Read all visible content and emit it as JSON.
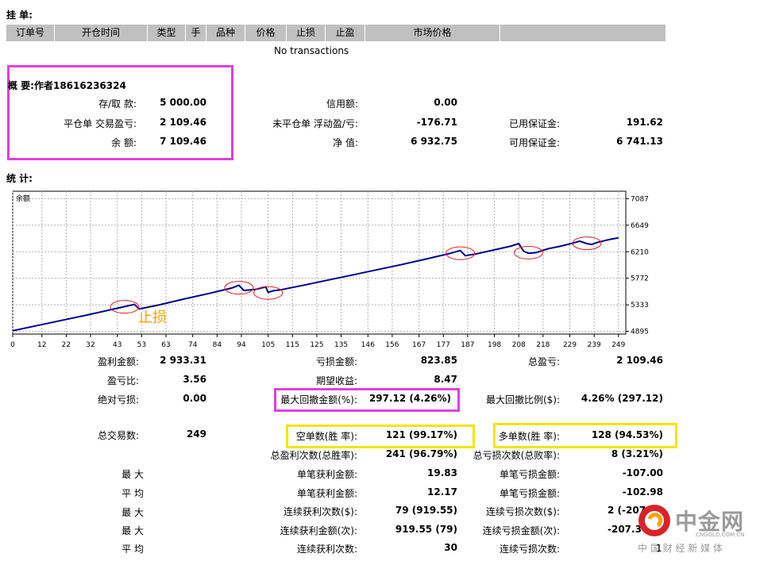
{
  "pending": {
    "title": "挂 单:",
    "columns": [
      "订单号",
      "开仓时间",
      "类型",
      "手",
      "品种",
      "价格",
      "止损",
      "止盈",
      "市场价格",
      ""
    ],
    "empty_text": "No transactions"
  },
  "summary": {
    "title": "概 要:作者18616236324",
    "rows": [
      {
        "label": "存/取 款:",
        "value": "5 000.00"
      },
      {
        "label": "平仓单 交易盈亏:",
        "value": "2 109.46"
      },
      {
        "label": "余 额:",
        "value": "7 109.46"
      },
      {
        "label": "信用额:",
        "value": "0.00"
      },
      {
        "label": "未平仓单 浮动盈/亏:",
        "value": "-176.71"
      },
      {
        "label": "净 值:",
        "value": "6 932.75"
      },
      {
        "label": "已用保证金:",
        "value": "191.62"
      },
      {
        "label": "可用保证金:",
        "value": "6 741.13"
      }
    ]
  },
  "stats_title": "统 计:",
  "chart_data": {
    "type": "line",
    "title": "余额",
    "x_ticks": [
      0,
      12,
      22,
      32,
      43,
      53,
      63,
      74,
      84,
      94,
      105,
      115,
      125,
      135,
      146,
      156,
      167,
      177,
      187,
      198,
      208,
      218,
      229,
      239,
      249
    ],
    "xlim": [
      0,
      252
    ],
    "y_ticks": [
      4895,
      5333,
      5772,
      6210,
      6649,
      7087
    ],
    "ylim": [
      4850,
      7210
    ],
    "grid": true,
    "annotation": "止损",
    "series": [
      {
        "color": "#00008b",
        "x": [
          0,
          10,
          20,
          30,
          40,
          50,
          52,
          60,
          70,
          80,
          90,
          93,
          95,
          100,
          104,
          105,
          107,
          110,
          120,
          130,
          140,
          150,
          160,
          170,
          180,
          184,
          186,
          190,
          200,
          205,
          208,
          210,
          212,
          215,
          220,
          225,
          230,
          233,
          236,
          238,
          240,
          245,
          249
        ],
        "y": [
          4905,
          4990,
          5075,
          5160,
          5250,
          5340,
          5265,
          5330,
          5425,
          5515,
          5610,
          5655,
          5570,
          5590,
          5630,
          5540,
          5565,
          5580,
          5660,
          5745,
          5830,
          5915,
          6000,
          6090,
          6185,
          6230,
          6145,
          6170,
          6260,
          6305,
          6345,
          6220,
          6185,
          6195,
          6260,
          6300,
          6350,
          6385,
          6345,
          6330,
          6360,
          6410,
          6440
        ]
      }
    ],
    "circles": [
      {
        "x": 46,
        "y": 5300
      },
      {
        "x": 93,
        "y": 5615
      },
      {
        "x": 105,
        "y": 5530
      },
      {
        "x": 184,
        "y": 6185
      },
      {
        "x": 212,
        "y": 6195
      },
      {
        "x": 236,
        "y": 6350
      }
    ]
  },
  "stats": [
    {
      "label": "盈利金额:",
      "value": "2 933.31"
    },
    {
      "label": "盈亏比:",
      "value": "3.56"
    },
    {
      "label": "绝对亏损:",
      "value": "0.00"
    },
    {
      "label": "总交易数:",
      "value": "249"
    },
    {
      "label": "最 大",
      "value": ""
    },
    {
      "label": "平 均",
      "value": ""
    },
    {
      "label": "最 大",
      "value": ""
    },
    {
      "label": "最 大",
      "value": ""
    },
    {
      "label": "平 均",
      "value": ""
    },
    {
      "label": "亏损金额:",
      "value": "823.85"
    },
    {
      "label": "期望收益:",
      "value": "8.47"
    },
    {
      "label": "最大回撤金额(%):",
      "value": "297.12 (4.26%)"
    },
    {
      "label": "空单数(胜 率):",
      "value": "121 (99.17%)"
    },
    {
      "label": "总盈利次数(总胜率):",
      "value": "241 (96.79%)"
    },
    {
      "label": "单笔获利金额:",
      "value": "19.83"
    },
    {
      "label": "单笔获利金额:",
      "value": "12.17"
    },
    {
      "label": "连续获利次数($):",
      "value": "79 (919.55)"
    },
    {
      "label": "连续获利金额(次):",
      "value": "919.55 (79)"
    },
    {
      "label": "连续获利次数:",
      "value": "30"
    },
    {
      "label": "总盈亏:",
      "value": "2 109.46"
    },
    {
      "label": "最大回撤比例($):",
      "value": "4.26% (297.12)"
    },
    {
      "label": "多单数(胜 率):",
      "value": "128 (94.53%)"
    },
    {
      "label": "总亏损次数(总败率):",
      "value": "8 (3.21%)"
    },
    {
      "label": "单笔亏损金额:",
      "value": "-107.00"
    },
    {
      "label": "单笔亏损金额:",
      "value": "-102.98"
    },
    {
      "label": "连续亏损次数($):",
      "value": "2 (-207"
    },
    {
      "label": "连续亏损金额(次):",
      "value": "-207.3"
    },
    {
      "label": "连续亏损次数:",
      "value": ""
    }
  ],
  "watermark": {
    "brand": "中金网",
    "domain": "CNGOLD.COM.CN",
    "slogan": "中 国 财 经 新 媒 体",
    "page": "1"
  }
}
